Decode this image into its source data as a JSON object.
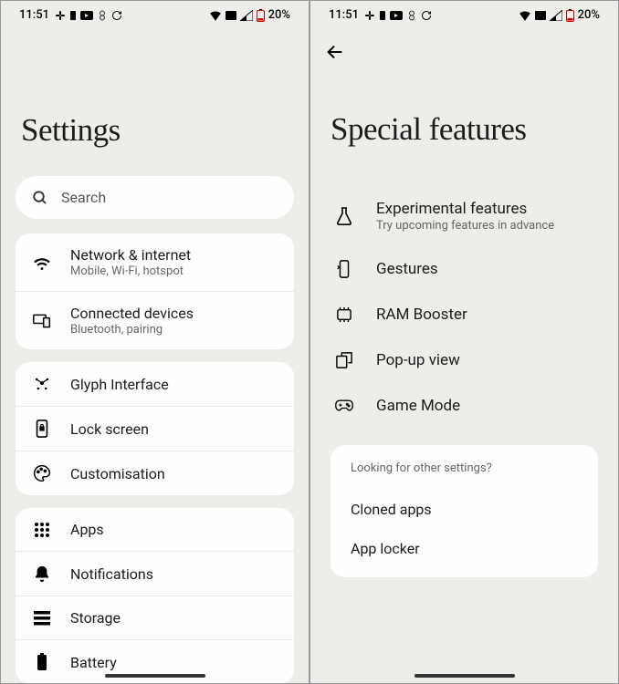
{
  "status": {
    "time": "11:51",
    "battery": "20%"
  },
  "left": {
    "title": "Settings",
    "search_placeholder": "Search",
    "groups": [
      {
        "items": [
          {
            "id": "network",
            "title": "Network & internet",
            "subtitle": "Mobile, Wi-Fi, hotspot"
          },
          {
            "id": "connected",
            "title": "Connected devices",
            "subtitle": "Bluetooth, pairing"
          }
        ]
      },
      {
        "items": [
          {
            "id": "glyph",
            "title": "Glyph Interface"
          },
          {
            "id": "lock",
            "title": "Lock screen"
          },
          {
            "id": "custom",
            "title": "Customisation"
          }
        ]
      },
      {
        "items": [
          {
            "id": "apps",
            "title": "Apps"
          },
          {
            "id": "notifications",
            "title": "Notifications"
          },
          {
            "id": "storage",
            "title": "Storage"
          },
          {
            "id": "battery",
            "title": "Battery"
          }
        ]
      }
    ]
  },
  "right": {
    "title": "Special features",
    "items": [
      {
        "id": "experimental",
        "title": "Experimental features",
        "subtitle": "Try upcoming features in advance"
      },
      {
        "id": "gestures",
        "title": "Gestures"
      },
      {
        "id": "ram",
        "title": "RAM Booster"
      },
      {
        "id": "popup",
        "title": "Pop-up view"
      },
      {
        "id": "game",
        "title": "Game Mode"
      }
    ],
    "other": {
      "heading": "Looking for other settings?",
      "items": [
        {
          "id": "cloned",
          "title": "Cloned apps"
        },
        {
          "id": "locker",
          "title": "App locker"
        }
      ]
    }
  }
}
